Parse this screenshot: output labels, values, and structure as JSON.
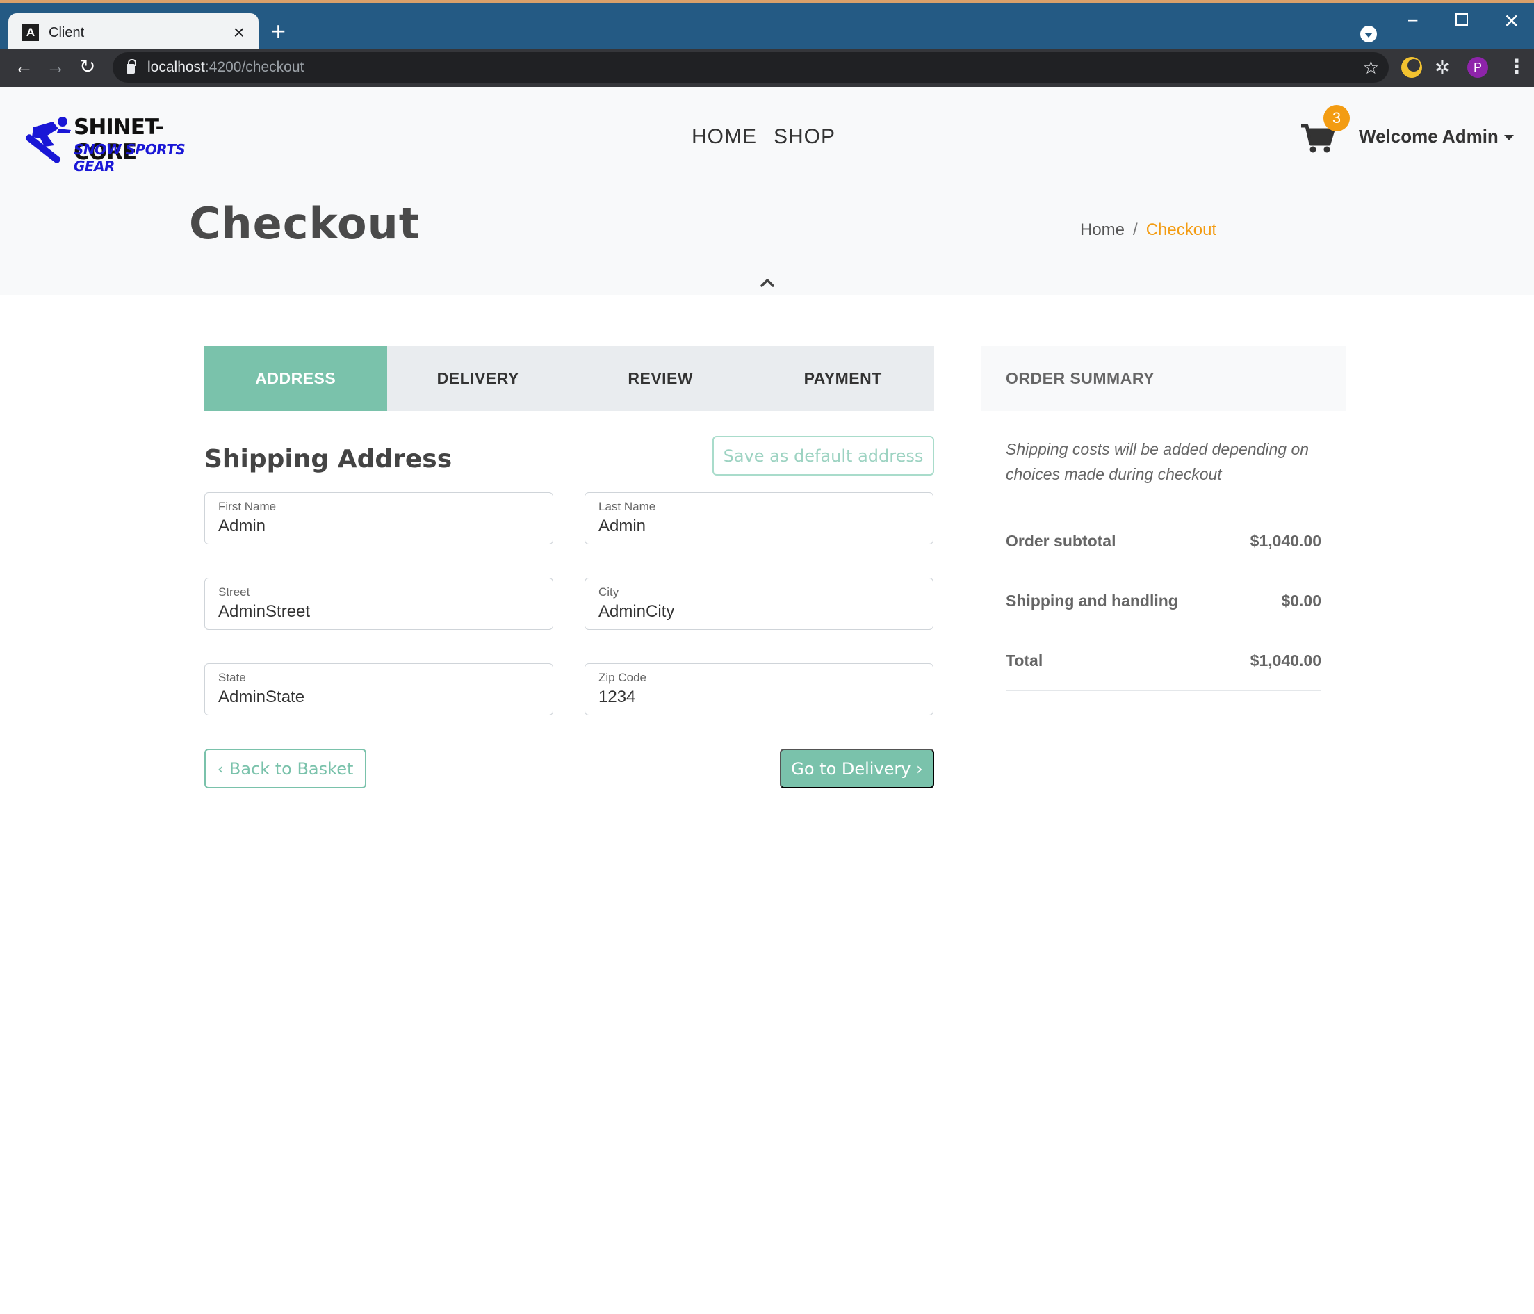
{
  "browser": {
    "tab_title": "Client",
    "favicon_letter": "A",
    "url_host": "localhost",
    "url_path": ":4200/checkout",
    "profile_initial": "P"
  },
  "site": {
    "logo_line1": "SHINET-CORE",
    "logo_line2": "SNOW SPORTS GEAR",
    "nav": [
      "HOME",
      "SHOP"
    ],
    "cart_count": "3",
    "welcome": "Welcome Admin"
  },
  "page": {
    "title": "Checkout",
    "breadcrumb_home": "Home",
    "breadcrumb_sep": "/",
    "breadcrumb_active": "Checkout"
  },
  "steps": [
    "ADDRESS",
    "DELIVERY",
    "REVIEW",
    "PAYMENT"
  ],
  "active_step": "ADDRESS",
  "shipping": {
    "title": "Shipping Address",
    "save_default": "Save as default address",
    "fields": [
      {
        "label": "First Name",
        "value": "Admin"
      },
      {
        "label": "Last Name",
        "value": "Admin"
      },
      {
        "label": "Street",
        "value": "AdminStreet"
      },
      {
        "label": "City",
        "value": "AdminCity"
      },
      {
        "label": "State",
        "value": "AdminState"
      },
      {
        "label": "Zip Code",
        "value": "1234"
      }
    ],
    "back_button": "‹ Back to Basket",
    "next_button": "Go to Delivery ›"
  },
  "summary": {
    "title": "ORDER SUMMARY",
    "note": "Shipping costs will be added depending on choices made during checkout",
    "rows": [
      {
        "label": "Order subtotal",
        "value": "$1,040.00"
      },
      {
        "label": "Shipping and handling",
        "value": "$0.00"
      },
      {
        "label": "Total",
        "value": "$1,040.00"
      }
    ]
  },
  "colors": {
    "accent": "#7ac2ab",
    "badge": "#f39c12",
    "breadcrumb_active": "#f39c12"
  }
}
